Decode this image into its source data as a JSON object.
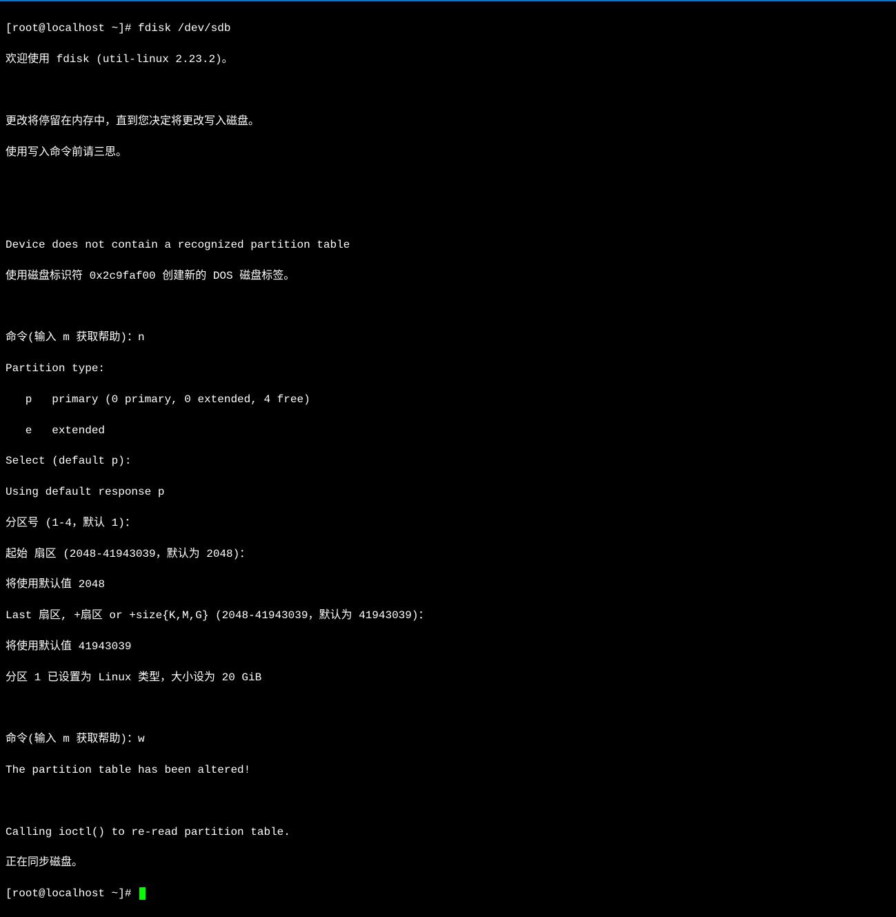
{
  "terminal": {
    "lines": [
      "[root@localhost ~]# fdisk /dev/sdb",
      "欢迎使用 fdisk (util-linux 2.23.2)。",
      "",
      "更改将停留在内存中，直到您决定将更改写入磁盘。",
      "使用写入命令前请三思。",
      "",
      "",
      "Device does not contain a recognized partition table",
      "使用磁盘标识符 0x2c9faf00 创建新的 DOS 磁盘标签。",
      "",
      "命令(输入 m 获取帮助)：n",
      "Partition type:",
      "   p   primary (0 primary, 0 extended, 4 free)",
      "   e   extended",
      "Select (default p):",
      "Using default response p",
      "分区号 (1-4，默认 1)：",
      "起始 扇区 (2048-41943039，默认为 2048)：",
      "将使用默认值 2048",
      "Last 扇区, +扇区 or +size{K,M,G} (2048-41943039，默认为 41943039)：",
      "将使用默认值 41943039",
      "分区 1 已设置为 Linux 类型，大小设为 20 GiB",
      "",
      "命令(输入 m 获取帮助)：w",
      "The partition table has been altered!",
      "",
      "Calling ioctl() to re-read partition table.",
      "正在同步磁盘。"
    ],
    "prompt": "[root@localhost ~]# "
  }
}
